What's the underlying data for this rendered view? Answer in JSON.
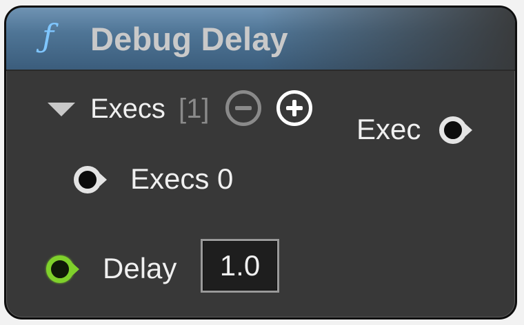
{
  "node": {
    "title": "Debug Delay",
    "icon": "function-icon",
    "icon_glyph": "ƒ",
    "header_color": "#4f7596"
  },
  "execs_array": {
    "label": "Execs",
    "count": "[1]",
    "remove_icon": "minus-circle-icon",
    "add_icon": "plus-circle-icon"
  },
  "pins": {
    "exec_output": {
      "label": "Exec",
      "icon": "exec-pin-icon"
    },
    "execs_0": {
      "label": "Execs 0",
      "icon": "exec-pin-icon"
    },
    "delay": {
      "label": "Delay",
      "value": "1.0",
      "icon": "float-pin-icon",
      "color": "#7fd12b"
    }
  }
}
